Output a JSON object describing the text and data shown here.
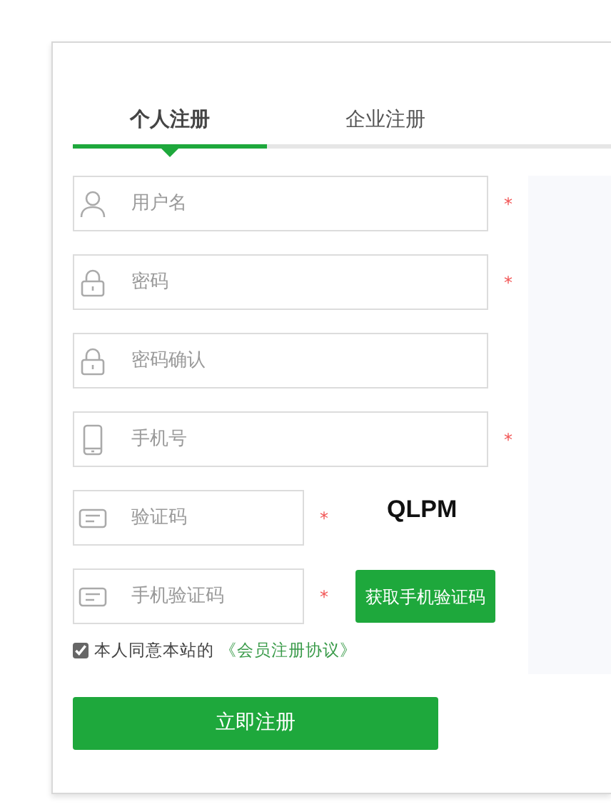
{
  "tabs": [
    {
      "label": "个人注册",
      "selected": true
    },
    {
      "label": "企业注册",
      "selected": false
    }
  ],
  "fields": [
    {
      "kind": "user",
      "placeholder": "用户名",
      "required_mark": "*"
    },
    {
      "kind": "lock",
      "placeholder": "密码",
      "required_mark": "*"
    },
    {
      "kind": "lock",
      "placeholder": "密码确认"
    },
    {
      "kind": "phone",
      "placeholder": "手机号",
      "required_mark": "*"
    },
    {
      "kind": "message",
      "placeholder": "验证码",
      "required_mark": "*",
      "captcha": "QLPM"
    },
    {
      "kind": "message",
      "placeholder": "手机验证码",
      "required_mark": "*",
      "button": "获取手机验证码"
    }
  ],
  "agreement": {
    "checked": true,
    "text": "本人同意本站的",
    "link": "《会员注册协议》"
  },
  "submit": "立即注册"
}
